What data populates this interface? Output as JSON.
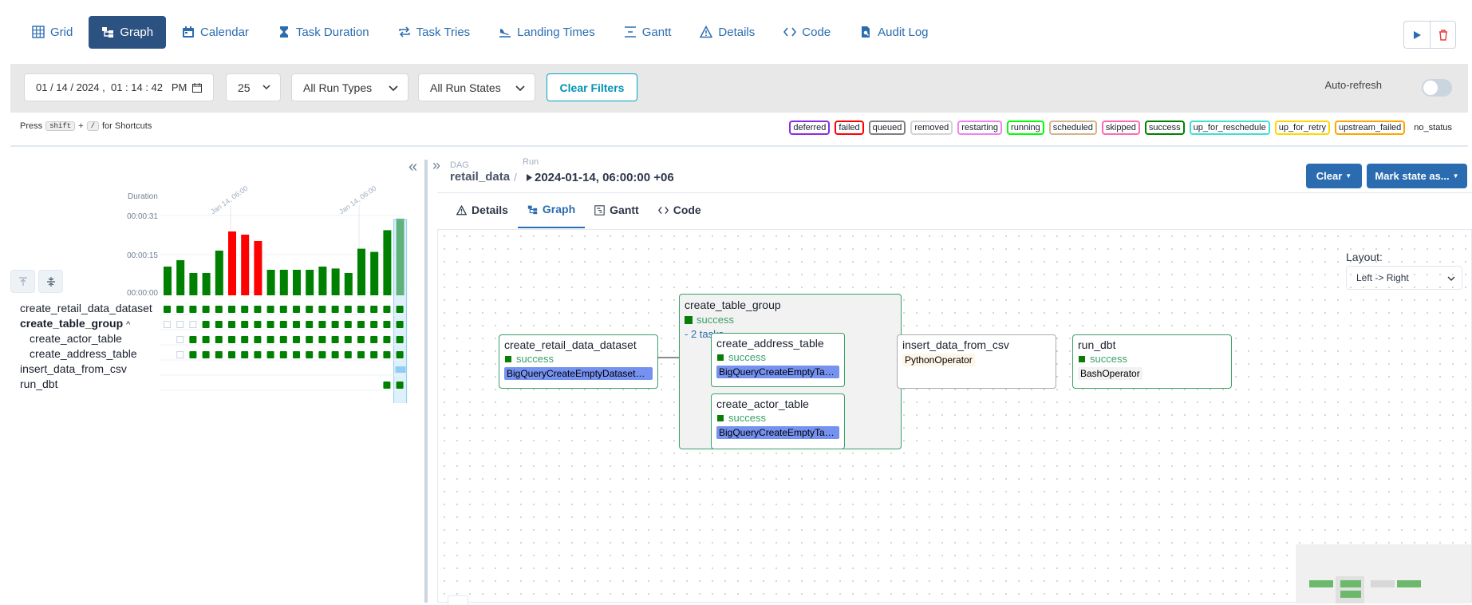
{
  "nav": {
    "tabs": [
      {
        "label": "Grid",
        "icon": "grid-icon"
      },
      {
        "label": "Graph",
        "icon": "graph-icon"
      },
      {
        "label": "Calendar",
        "icon": "calendar-icon"
      },
      {
        "label": "Task Duration",
        "icon": "hourglass-icon"
      },
      {
        "label": "Task Tries",
        "icon": "repeat-icon"
      },
      {
        "label": "Landing Times",
        "icon": "plane-landing-icon"
      },
      {
        "label": "Gantt",
        "icon": "gantt-icon"
      },
      {
        "label": "Details",
        "icon": "warning-triangle-icon"
      },
      {
        "label": "Code",
        "icon": "code-icon"
      },
      {
        "label": "Audit Log",
        "icon": "audit-log-icon"
      }
    ],
    "active_tab": "Graph"
  },
  "filters": {
    "date_value": "01 / 14 / 2024 ,  01 : 14 : 42   PM",
    "num_runs": "25",
    "run_types": "All Run Types",
    "run_states": "All Run States",
    "clear_filters": "Clear Filters",
    "auto_refresh": "Auto-refresh"
  },
  "shortcuts": {
    "press": "Press",
    "key1": "shift",
    "plus": "+",
    "key2": "/",
    "suffix": "for Shortcuts"
  },
  "legend": [
    {
      "label": "deferred",
      "color": "#8a2be2"
    },
    {
      "label": "failed",
      "color": "#ff0000"
    },
    {
      "label": "queued",
      "color": "#808080"
    },
    {
      "label": "removed",
      "color": "#d3d3d3"
    },
    {
      "label": "restarting",
      "color": "#ee82ee"
    },
    {
      "label": "running",
      "color": "#00ff00"
    },
    {
      "label": "scheduled",
      "color": "#d2b48c"
    },
    {
      "label": "skipped",
      "color": "#ff69b4"
    },
    {
      "label": "success",
      "color": "#008000"
    },
    {
      "label": "up_for_reschedule",
      "color": "#40e0d0"
    },
    {
      "label": "up_for_retry",
      "color": "#ffd700"
    },
    {
      "label": "upstream_failed",
      "color": "#ffa500"
    },
    {
      "label": "no_status",
      "color": "#ffffff"
    }
  ],
  "grid": {
    "duration_label": "Duration",
    "y_ticks": [
      "00:00:31",
      "00:00:15",
      "00:00:00"
    ],
    "date_labels": [
      "Jan 14, 06:00",
      "Jan 14, 06:00"
    ],
    "bar_values": [
      0.45,
      0.55,
      0.35,
      0.35,
      0.7,
      1.0,
      0.95,
      0.85,
      0.4,
      0.4,
      0.4,
      0.4,
      0.45,
      0.42,
      0.35,
      0.73,
      0.68,
      1.02,
      1.2
    ],
    "bar_states": [
      "success",
      "success",
      "success",
      "success",
      "success",
      "failed",
      "failed",
      "failed",
      "success",
      "success",
      "success",
      "success",
      "success",
      "success",
      "success",
      "success",
      "success",
      "success",
      "success"
    ],
    "tasks": [
      {
        "label": "create_retail_data_dataset",
        "bold": false
      },
      {
        "label": "create_table_group",
        "bold": true,
        "caret": "^"
      },
      {
        "label": "create_actor_table",
        "bold": false
      },
      {
        "label": "create_address_table",
        "bold": false
      },
      {
        "label": "insert_data_from_csv",
        "bold": false
      },
      {
        "label": "run_dbt",
        "bold": false
      }
    ]
  },
  "header": {
    "dag_caption": "DAG",
    "dag_name": "retail_data",
    "run_caption": "Run",
    "run_id": "2024-01-14, 06:00:00 +06",
    "clear_btn": "Clear",
    "mark_btn": "Mark state as..."
  },
  "subtabs": [
    {
      "label": "Details",
      "icon": "warning-triangle-icon"
    },
    {
      "label": "Graph",
      "icon": "graph-icon"
    },
    {
      "label": "Gantt",
      "icon": "gantt-icon"
    },
    {
      "label": "Code",
      "icon": "code-icon"
    }
  ],
  "graph": {
    "layout_label": "Layout:",
    "layout_value": "Left -> Right",
    "group": {
      "name": "create_table_group",
      "state": "success",
      "tasks": "- 2 tasks"
    },
    "nodes": [
      {
        "name": "create_retail_data_dataset",
        "state": "success",
        "op": "BigQueryCreateEmptyDatasetOperator"
      },
      {
        "name": "create_address_table",
        "state": "success",
        "op": "BigQueryCreateEmptyTableOperator"
      },
      {
        "name": "create_actor_table",
        "state": "success",
        "op": "BigQueryCreateEmptyTableOperator"
      },
      {
        "name": "insert_data_from_csv",
        "state": "",
        "op": "PythonOperator"
      },
      {
        "name": "run_dbt",
        "state": "success",
        "op": "BashOperator"
      }
    ]
  },
  "colors": {
    "accent": "#2c5282",
    "success": "#008000",
    "failed": "#ff0000"
  }
}
